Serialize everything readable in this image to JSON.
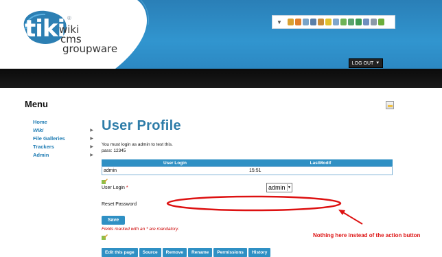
{
  "header": {
    "logo": {
      "tiki": "tiki",
      "reg": "®",
      "line1": "wiki",
      "line2": "cms",
      "line3": "groupware"
    },
    "toolbar_arrow": "▼",
    "toolbar_icons": [
      "wrench-icon",
      "home-icon",
      "pencil-icon",
      "user-icon",
      "users-icon",
      "key-icon",
      "window-icon",
      "plugin-icon",
      "modules-icon",
      "star-icon",
      "document-icon",
      "list-icon",
      "gear-icon"
    ],
    "logout_label": "LOG OUT",
    "logout_caret": "▼"
  },
  "sidebar": {
    "title": "Menu",
    "items": [
      {
        "label": "Home",
        "has_arrow": false,
        "italic": false
      },
      {
        "label": "Wiki",
        "has_arrow": true,
        "italic": true
      },
      {
        "label": "File Galleries",
        "has_arrow": true,
        "italic": false
      },
      {
        "label": "Trackers",
        "has_arrow": true,
        "italic": false
      },
      {
        "label": "Admin",
        "has_arrow": true,
        "italic": false
      }
    ],
    "arrow_glyph": "▶"
  },
  "main": {
    "title": "User Profile",
    "notice_line1": "You must login as admin to test this.",
    "notice_line2": "pass: 12345",
    "table": {
      "headers": [
        "User Login",
        "LastModif"
      ],
      "rows": [
        [
          "admin",
          "15:51"
        ]
      ]
    },
    "user_login_label": "User Login",
    "required_mark": "*",
    "user_login_value": "admin",
    "select_caret": "▼",
    "reset_password_label": "Reset Password",
    "save_label": "Save",
    "mandatory_note": "Fields marked with an * are mandatory.",
    "actions": [
      "Edit this page",
      "Source",
      "Remove",
      "Rename",
      "Permissions",
      "History"
    ]
  },
  "annotation": {
    "text": "Nothing here instead of the action button",
    "color": "#dd1111"
  },
  "colors": {
    "header_blue": "#2c8ac4",
    "accent": "#2f90c4",
    "link": "#1d7bb3",
    "title": "#2d7ca8"
  }
}
